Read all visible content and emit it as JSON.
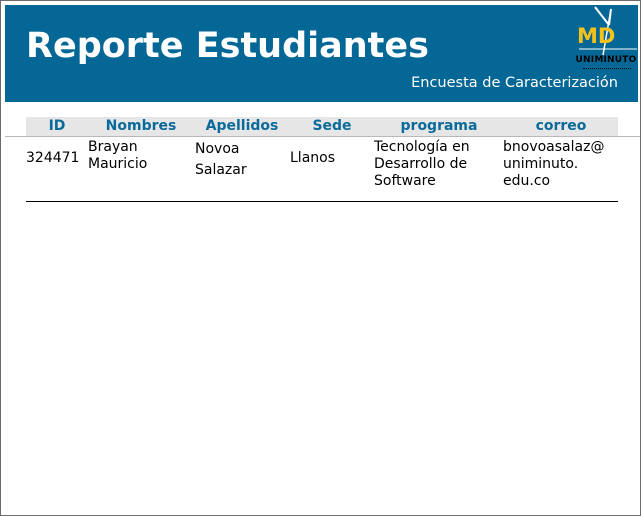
{
  "header": {
    "title": "Reporte Estudiantes",
    "subtitle": "Encuesta de Caracterización",
    "logo": {
      "mark": "MD",
      "name": "UNIMINUTO"
    }
  },
  "table": {
    "columns": [
      "ID",
      "Nombres",
      "Apellidos",
      "Sede",
      "programa",
      "correo"
    ],
    "rows": [
      {
        "id": "324471",
        "nombres": [
          "Brayan",
          "Mauricio"
        ],
        "apellidos": [
          "Novoa",
          "Salazar"
        ],
        "sede": "Llanos",
        "programa": [
          "Tecnología en",
          "Desarrollo de",
          "Software"
        ],
        "correo": [
          "bnovoasalaz@",
          "uniminuto.",
          "edu.co"
        ]
      }
    ]
  },
  "colors": {
    "header_bg": "#046795",
    "header_text": "#ffffff",
    "column_header_text": "#0a6a9a",
    "column_header_bg": "#e6e6e6",
    "logo_yellow": "#f6c11b"
  }
}
